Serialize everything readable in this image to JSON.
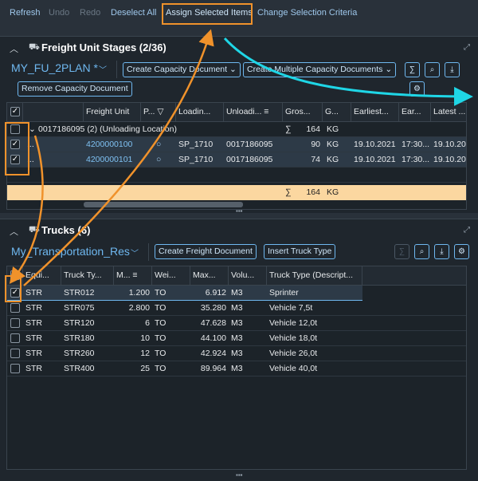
{
  "toolbar": {
    "refresh": "Refresh",
    "undo": "Undo",
    "redo": "Redo",
    "deselect_all": "Deselect All",
    "assign_selected": "Assign Selected Items",
    "change_criteria": "Change Selection Criteria"
  },
  "fu_panel": {
    "title": "Freight Unit Stages (2/36)",
    "variant": "MY_FU_2PLAN *",
    "btn_create_capacity": "Create Capacity Document",
    "btn_create_multiple": "Create Multiple Capacity Documents",
    "btn_remove_capacity": "Remove Capacity Document",
    "sum_symbol": "∑",
    "columns": [
      "Freight Unit",
      "P...",
      "Loadin...",
      "Unloadi...",
      "Gros...",
      "G...",
      "Earliest...",
      "Ear...",
      "Latest ..."
    ],
    "group_row": {
      "label": "0017186095 (2) (Unloading Location)",
      "sum": "164",
      "unit": "KG"
    },
    "rows": [
      {
        "dots": "...",
        "fu": "4200000100",
        "loading": "SP_1710",
        "unloading": "0017186095",
        "gross": "90",
        "unit": "KG",
        "earliest": "19.10.2021",
        "ear": "17:30...",
        "latest": "19.10.20"
      },
      {
        "dots": "...",
        "fu": "4200000101",
        "loading": "SP_1710",
        "unloading": "0017186095",
        "gross": "74",
        "unit": "KG",
        "earliest": "19.10.2021",
        "ear": "17:30...",
        "latest": "19.10.20"
      }
    ],
    "total_row": {
      "sum": "164",
      "unit": "KG"
    }
  },
  "truck_panel": {
    "title": "Trucks (6)",
    "variant": "My_Transportation_Res",
    "btn_create_fo": "Create Freight Document",
    "btn_insert_truck": "Insert Truck Type",
    "columns": [
      "Equi...",
      "Truck Ty...",
      "M...",
      "Wei...",
      "Max...",
      "Volu...",
      "Truck Type (Descript..."
    ],
    "rows": [
      {
        "equi": "STR",
        "truck": "STR012",
        "m": "1.200",
        "wei": "TO",
        "max": "6.912",
        "vol": "M3",
        "desc": "Sprinter",
        "checked": true
      },
      {
        "equi": "STR",
        "truck": "STR075",
        "m": "2.800",
        "wei": "TO",
        "max": "35.280",
        "vol": "M3",
        "desc": "Vehicle 7,5t",
        "checked": false
      },
      {
        "equi": "STR",
        "truck": "STR120",
        "m": "6",
        "wei": "TO",
        "max": "47.628",
        "vol": "M3",
        "desc": "Vehicle 12,0t",
        "checked": false
      },
      {
        "equi": "STR",
        "truck": "STR180",
        "m": "10",
        "wei": "TO",
        "max": "44.100",
        "vol": "M3",
        "desc": "Vehicle 18,0t",
        "checked": false
      },
      {
        "equi": "STR",
        "truck": "STR260",
        "m": "12",
        "wei": "TO",
        "max": "42.924",
        "vol": "M3",
        "desc": "Vehicle 26,0t",
        "checked": false
      },
      {
        "equi": "STR",
        "truck": "STR400",
        "m": "25",
        "wei": "TO",
        "max": "89.964",
        "vol": "M3",
        "desc": "Vehicle 40,0t",
        "checked": false
      }
    ]
  },
  "colors": {
    "accent": "#6fb8f0",
    "annotation_orange": "#f0922b",
    "annotation_cyan": "#1fd6e6",
    "total_row": "#fbd7a0"
  }
}
